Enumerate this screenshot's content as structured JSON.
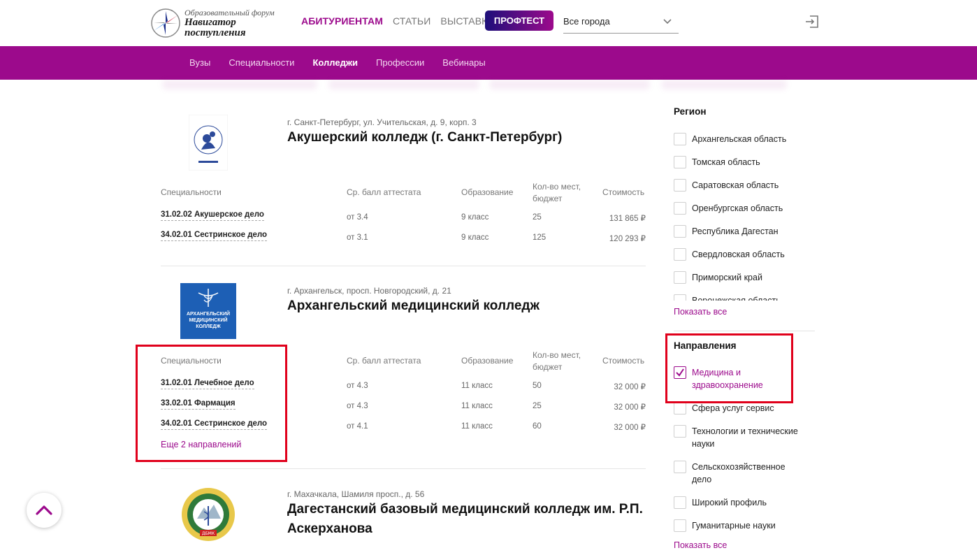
{
  "header": {
    "logo_sub": "Образовательный форум",
    "logo_main_1": "Навигатор",
    "logo_main_2": "поступления",
    "nav": [
      {
        "label": "АБИТУРИЕНТАМ",
        "active": true
      },
      {
        "label": "СТАТЬИ",
        "active": false
      },
      {
        "label": "ВЫСТАВКА",
        "active": false
      }
    ],
    "proftest_label": "ПРОФТЕСТ",
    "city_value": "Все города",
    "accent_color": "#9c0a8c"
  },
  "subnav": {
    "items": [
      {
        "label": "Вузы"
      },
      {
        "label": "Специальности"
      },
      {
        "label": "Колледжи",
        "current": true
      },
      {
        "label": "Профессии"
      },
      {
        "label": "Вебинары"
      }
    ]
  },
  "table_headers": {
    "spec": "Специальности",
    "score": "Ср. балл аттестата",
    "education": "Образование",
    "places_1": "Кол-во мест,",
    "places_2": "бюджет",
    "cost": "Стоимость"
  },
  "colleges": [
    {
      "address": "г. Санкт-Петербург, ул. Учительская, д. 9, корп. 3",
      "name": "Акушерский колледж (г. Санкт-Петербург)",
      "rows": [
        {
          "spec": "31.02.02 Акушерское дело",
          "score": "от 3.4",
          "education": "9 класс",
          "places": "25",
          "cost": "131 865 ₽"
        },
        {
          "spec": "34.02.01 Сестринское дело",
          "score": "от 3.1",
          "education": "9 класс",
          "places": "125",
          "cost": "120 293 ₽"
        }
      ]
    },
    {
      "address": "г. Архангельск, просп. Новгородский, д. 21",
      "name": "Архангельский медицинский колледж",
      "logo_text_1": "АРХАНГЕЛЬСКИЙ",
      "logo_text_2": "МЕДИЦИНСКИЙ",
      "logo_text_3": "КОЛЛЕДЖ",
      "rows": [
        {
          "spec": "31.02.01 Лечебное дело",
          "score": "от 4.3",
          "education": "11 класс",
          "places": "50",
          "cost": "32 000 ₽"
        },
        {
          "spec": "33.02.01 Фармация",
          "score": "от 4.3",
          "education": "11 класс",
          "places": "25",
          "cost": "32 000 ₽"
        },
        {
          "spec": "34.02.01 Сестринское дело",
          "score": "от 4.1",
          "education": "11 класс",
          "places": "60",
          "cost": "32 000 ₽"
        }
      ],
      "more_label": "Еще 2 направлений"
    },
    {
      "address": "г. Махачкала, Шамиля просп., д. 56",
      "name": "Дагестанский базовый медицинский колледж им. Р.П. Аскерханова",
      "logo_abbr": "ДБМК"
    }
  ],
  "filters": {
    "region_title": "Регион",
    "regions": [
      "Архангельская область",
      "Томская область",
      "Саратовская область",
      "Оренбургская область",
      "Республика Дагестан",
      "Свердловская область",
      "Приморский край",
      "Воронежская область"
    ],
    "show_all": "Показать все",
    "directions_title": "Направления",
    "directions": [
      {
        "label_1": "Медицина и",
        "label_2": "здравоохранение",
        "checked": true
      },
      {
        "label_1": "Сфера услуг сервис",
        "label_2": "",
        "checked": false
      },
      {
        "label_1": "Технологии и технические",
        "label_2": "науки",
        "checked": false
      },
      {
        "label_1": "Сельскохозяйственное",
        "label_2": "дело",
        "checked": false
      },
      {
        "label_1": "Широкий профиль",
        "label_2": "",
        "checked": false
      },
      {
        "label_1": "Гуманитарные науки",
        "label_2": "",
        "checked": false
      }
    ],
    "show_all_2": "Показать все"
  }
}
